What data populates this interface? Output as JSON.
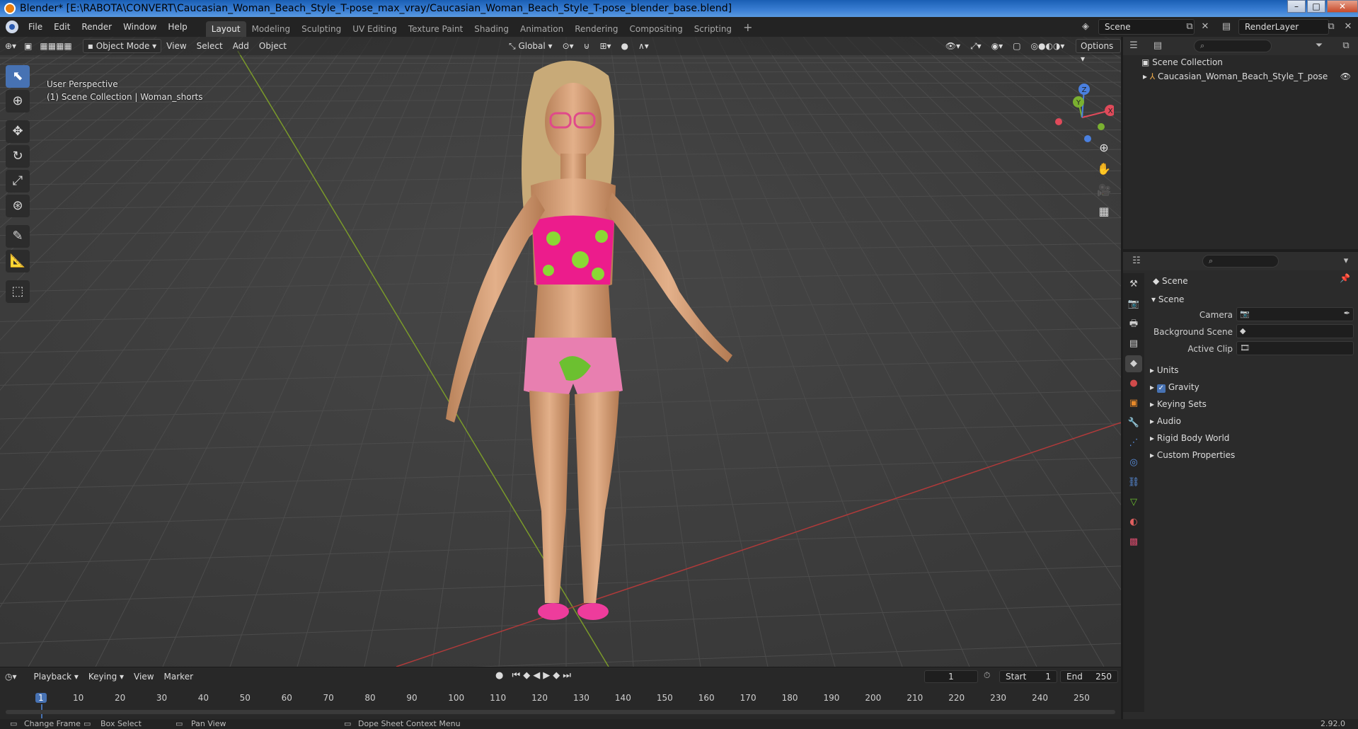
{
  "window": {
    "title": "Blender* [E:\\RABOTA\\CONVERT\\Caucasian_Woman_Beach_Style_T-pose_max_vray/Caucasian_Woman_Beach_Style_T-pose_blender_base.blend]"
  },
  "menu": [
    "File",
    "Edit",
    "Render",
    "Window",
    "Help"
  ],
  "workspaces": [
    "Layout",
    "Modeling",
    "Sculpting",
    "UV Editing",
    "Texture Paint",
    "Shading",
    "Animation",
    "Rendering",
    "Compositing",
    "Scripting"
  ],
  "active_workspace": "Layout",
  "scene_name": "Scene",
  "view_layer": "RenderLayer",
  "viewport": {
    "mode": "Object Mode",
    "menus": [
      "View",
      "Select",
      "Add",
      "Object"
    ],
    "transform_orientation": "Global",
    "options_label": "Options",
    "info_line1": "User Perspective",
    "info_line2": "(1) Scene Collection | Woman_shorts",
    "gizmo_axes": {
      "x": "X",
      "y": "Y",
      "z": "Z"
    }
  },
  "outliner": {
    "root": "Scene Collection",
    "items": [
      {
        "label": "Caucasian_Woman_Beach_Style_T_pose"
      }
    ]
  },
  "properties": {
    "context": "Scene",
    "panel_title": "Scene",
    "fields": [
      {
        "label": "Camera"
      },
      {
        "label": "Background Scene"
      },
      {
        "label": "Active Clip"
      }
    ],
    "sections": [
      "Units",
      "Gravity",
      "Keying Sets",
      "Audio",
      "Rigid Body World",
      "Custom Properties"
    ],
    "gravity_checked": true
  },
  "timeline": {
    "menus": [
      "Playback",
      "Keying",
      "View",
      "Marker"
    ],
    "current_frame": "1",
    "start_label": "Start",
    "start_value": "1",
    "end_label": "End",
    "end_value": "250",
    "ticks": [
      "1",
      "10",
      "20",
      "30",
      "40",
      "50",
      "60",
      "70",
      "80",
      "90",
      "100",
      "110",
      "120",
      "130",
      "140",
      "150",
      "160",
      "170",
      "180",
      "190",
      "200",
      "210",
      "220",
      "230",
      "240",
      "250"
    ]
  },
  "statusbar": {
    "hint1": "Change Frame",
    "hint2": "Box Select",
    "hint3": "Pan View",
    "hint4": "Dope Sheet Context Menu",
    "version": "2.92.0"
  }
}
